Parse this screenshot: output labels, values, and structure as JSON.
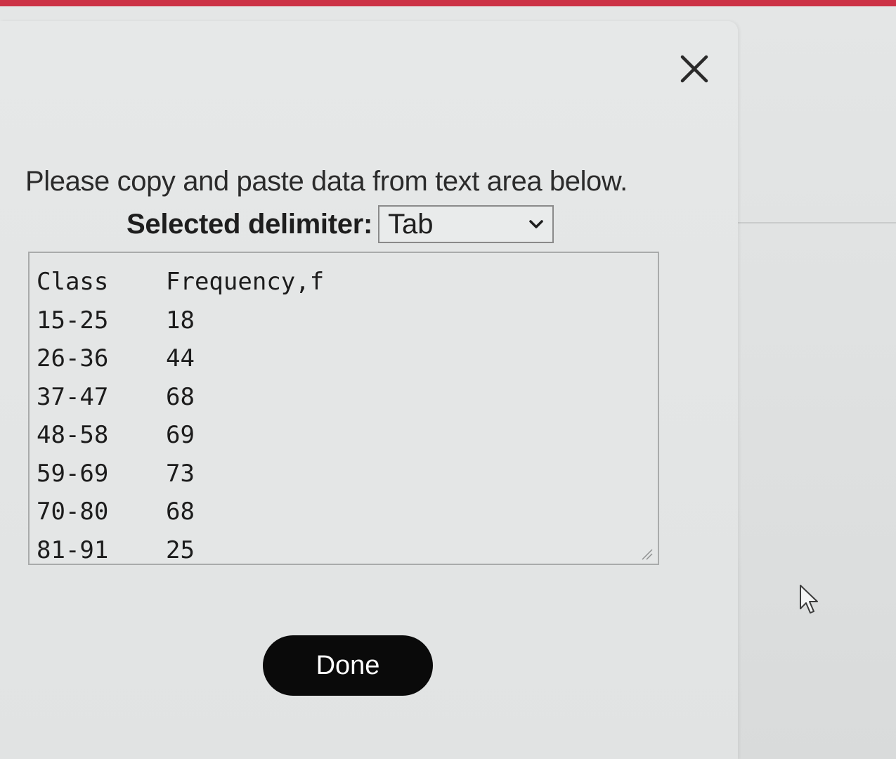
{
  "dialog": {
    "instructions": "Please copy and paste data from text area below.",
    "delimiter_label": "Selected delimiter:",
    "delimiter_value": "Tab",
    "close_icon": "close-icon",
    "done_label": "Done"
  },
  "data_table": {
    "headers": [
      "Class",
      "Frequency,f"
    ],
    "rows": [
      [
        "15-25",
        "18"
      ],
      [
        "26-36",
        "44"
      ],
      [
        "37-47",
        "68"
      ],
      [
        "48-58",
        "69"
      ],
      [
        "59-69",
        "73"
      ],
      [
        "70-80",
        "68"
      ],
      [
        "81-91",
        "25"
      ]
    ]
  },
  "colors": {
    "accent_bar": "#cc3246",
    "button_bg": "#0a0a0a",
    "button_text": "#ffffff"
  }
}
